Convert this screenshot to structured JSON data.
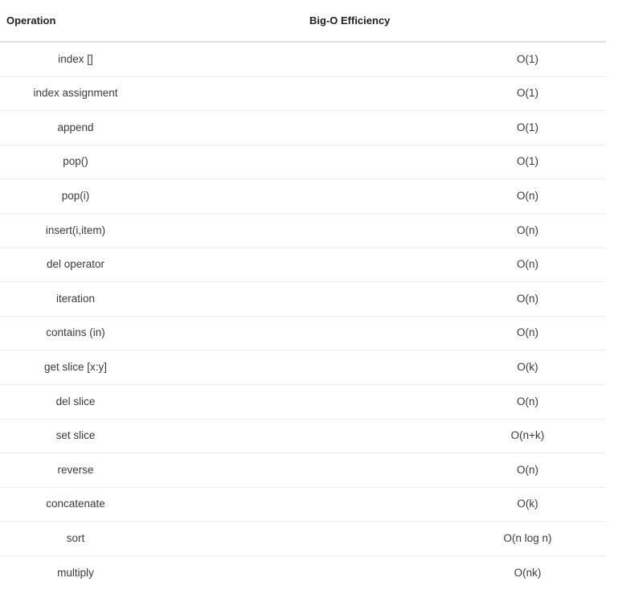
{
  "table": {
    "columns": [
      {
        "key": "operation",
        "label": "Operation"
      },
      {
        "key": "efficiency",
        "label": "Big-O Efficiency"
      }
    ],
    "rows": [
      {
        "operation": "index []",
        "efficiency": "O(1)"
      },
      {
        "operation": "index assignment",
        "efficiency": "O(1)"
      },
      {
        "operation": "append",
        "efficiency": "O(1)"
      },
      {
        "operation": "pop()",
        "efficiency": "O(1)"
      },
      {
        "operation": "pop(i)",
        "efficiency": "O(n)"
      },
      {
        "operation": "insert(i,item)",
        "efficiency": "O(n)"
      },
      {
        "operation": "del operator",
        "efficiency": "O(n)"
      },
      {
        "operation": "iteration",
        "efficiency": "O(n)"
      },
      {
        "operation": "contains (in)",
        "efficiency": "O(n)"
      },
      {
        "operation": "get slice [x:y]",
        "efficiency": "O(k)"
      },
      {
        "operation": "del slice",
        "efficiency": "O(n)"
      },
      {
        "operation": "set slice",
        "efficiency": "O(n+k)"
      },
      {
        "operation": "reverse",
        "efficiency": "O(n)"
      },
      {
        "operation": "concatenate",
        "efficiency": "O(k)"
      },
      {
        "operation": "sort",
        "efficiency": "O(n log n)"
      },
      {
        "operation": "multiply",
        "efficiency": "O(nk)"
      }
    ],
    "colors": {
      "header_text": "#222222",
      "body_text": "#3a3a3a",
      "header_rule": "#dddddd",
      "row_rule": "#eeeeee",
      "background": "#ffffff"
    }
  }
}
